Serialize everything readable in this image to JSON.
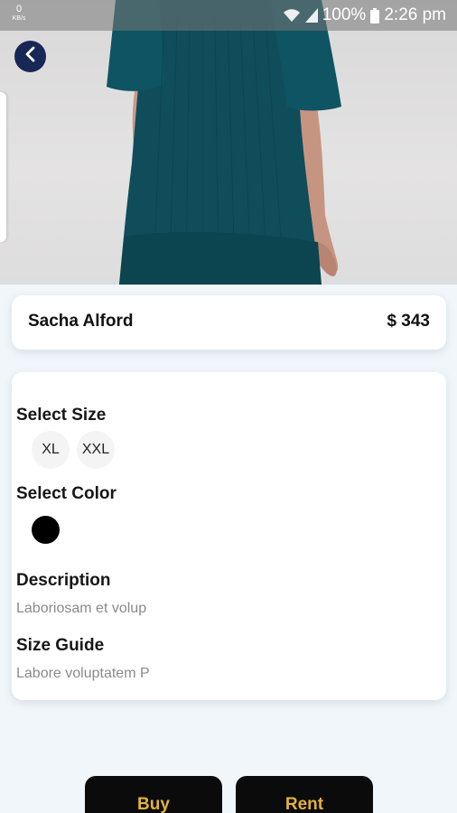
{
  "status_bar": {
    "net_speed_value": "0",
    "net_speed_unit": "KB/s",
    "battery_percent": "100%",
    "time": "2:26 pm"
  },
  "product": {
    "name": "Sacha Alford",
    "price": "$ 343"
  },
  "size_section": {
    "label": "Select Size",
    "options": [
      "XL",
      "XXL"
    ]
  },
  "color_section": {
    "label": "Select Color",
    "options": [
      "#000000"
    ]
  },
  "description": {
    "label": "Description",
    "text": "Laboriosam et volup"
  },
  "size_guide": {
    "label": "Size Guide",
    "text": "Labore voluptatem P"
  },
  "actions": {
    "buy_label": "Buy",
    "rent_label": "Rent"
  },
  "colors": {
    "accent": "#e2b23a",
    "back_button": "#172756",
    "dress": "#0f4d5b",
    "background": "#f1f6fa"
  },
  "icons": {
    "back": "chevron-left-icon",
    "wifi": "wifi-icon",
    "signal": "signal-icon",
    "battery": "battery-icon"
  }
}
